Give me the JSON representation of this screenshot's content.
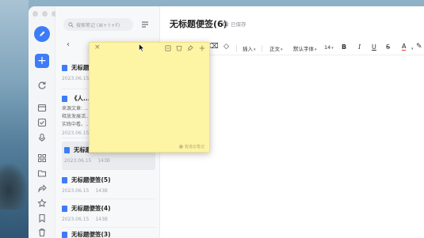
{
  "app": {
    "brand_color": "#3d7cf6"
  },
  "search": {
    "placeholder": "搜索笔记 (⌘+⇧+F)"
  },
  "notes": [
    {
      "title": "无标题便...",
      "date": "2023.06.15",
      "size": ""
    },
    {
      "title": "《人...",
      "desc_lines": [
        "来源文章: ...",
        "释放发展活...",
        "实践中看。..."
      ],
      "date": "2023.06.15",
      "size": ""
    },
    {
      "title": "无标题便...",
      "date": "2023.06.15",
      "size": "143B"
    },
    {
      "title": "无标题便签(5)",
      "date": "2023.06.15",
      "size": "143B"
    },
    {
      "title": "无标题便签(4)",
      "date": "2023.06.15",
      "size": "143B"
    },
    {
      "title": "无标题便签(3)",
      "date": "",
      "size": ""
    }
  ],
  "editor": {
    "title": "无标题便签(6)",
    "saved": "已保存",
    "toolbar": {
      "insert": "插入",
      "text_style": "正文",
      "font": "默认字体",
      "size": "14",
      "bold": "B",
      "italic": "I",
      "underline": "U",
      "strike": "S",
      "font_color_letter": "A"
    }
  },
  "sticky": {
    "close": "×",
    "brand": "有道云笔记",
    "bg": "#fdf4a4"
  }
}
